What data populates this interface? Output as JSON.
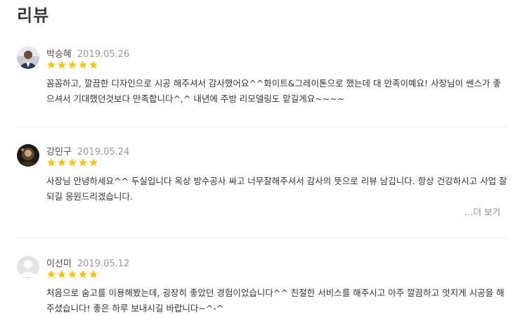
{
  "section": {
    "title": "리뷰"
  },
  "reviews": [
    {
      "name": "박승혜",
      "date": "2019.05.26",
      "rating": 5,
      "avatar_icon": "user-photo-avatar",
      "text": "꼼꼼하고, 깔끔한 디자인으로 시공 해주셔서 감사했어요^^화이트&그레이톤으로 했는데 대 만족이예요! 사장님이 쎈스가 좋으셔서 기대했던것보다 만족합니다^,^ 내년에 주방 리모델링도 맡길게요~~~~"
    },
    {
      "name": "강민구",
      "date": "2019.05.24",
      "rating": 5,
      "avatar_icon": "user-photo-avatar",
      "text": "사장님 안녕하세요^^ 두실입니다 옥상 방수공사 싸고 너무잘해주셔서 감사의 뜻으로 리뷰 남깁니다. 항상 건강하시고 사업 잘되길 응원드리겠습니다.",
      "more_label": "…더 보기"
    },
    {
      "name": "이선미",
      "date": "2019.05.12",
      "rating": 5,
      "avatar_icon": "default-user-avatar",
      "text": "처음으로 숨고를 이용해봤는데, 굉장히 좋았던 경험이었습니다^^ 친절한 서비스를 해주시고 아주 깔끔하고 멋지게 시공을 해주셨습니다! 좋은 하루 보내시길 바랍니다~^-^"
    }
  ],
  "colors": {
    "star": "#f5c518",
    "date": "#999999",
    "divider": "#eeeeee"
  }
}
